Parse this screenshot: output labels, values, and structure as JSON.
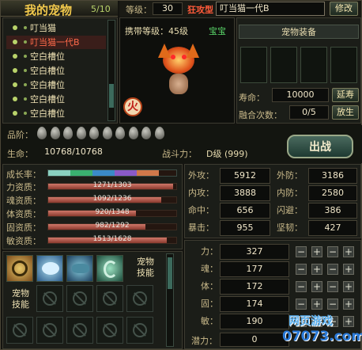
{
  "title": "我的宠物",
  "count": "5/10",
  "level_label": "等级：",
  "level": "30",
  "type": "狂攻型",
  "pet_name": "叮当猫一代B",
  "rename": "修改",
  "pets": [
    "叮当猫",
    "叮当猫一代B",
    "空白槽位",
    "空白槽位",
    "空白槽位",
    "空白槽位",
    "空白槽位"
  ],
  "carry_label": "携带等级：45级",
  "baby": "宝宝",
  "equip_title": "宠物装备",
  "life_label": "寿命：",
  "life": "10000",
  "extend": "延寿",
  "fuse_label": "融合次数：",
  "fuse": "0/5",
  "release": "放生",
  "grade_label": "品阶：",
  "hp_label": "生命：",
  "hp": "10768/10768",
  "power_label": "战斗力：",
  "power": "D级 (999)",
  "battle": "出战",
  "growth_label": "成长率：",
  "aptitudes": [
    {
      "label": "力资质：",
      "text": "1271/1303",
      "pct": 0.975
    },
    {
      "label": "魂资质：",
      "text": "1092/1236",
      "pct": 0.883
    },
    {
      "label": "体资质：",
      "text": "920/1348",
      "pct": 0.683
    },
    {
      "label": "固资质：",
      "text": "982/1292",
      "pct": 0.76
    },
    {
      "label": "敏资质：",
      "text": "1513/1628",
      "pct": 0.929
    }
  ],
  "stats": [
    {
      "l1": "外攻：",
      "v1": "5912",
      "l2": "外防：",
      "v2": "3186"
    },
    {
      "l1": "内攻：",
      "v1": "3888",
      "l2": "内防：",
      "v2": "2580"
    },
    {
      "l1": "命中：",
      "v1": "656",
      "l2": "闪避：",
      "v2": "386"
    },
    {
      "l1": "暴击：",
      "v1": "955",
      "l2": "坚韧：",
      "v2": "427"
    }
  ],
  "attrs": [
    {
      "label": "力：",
      "value": "327"
    },
    {
      "label": "魂：",
      "value": "177"
    },
    {
      "label": "体：",
      "value": "172"
    },
    {
      "label": "固：",
      "value": "174"
    },
    {
      "label": "敏：",
      "value": "190"
    }
  ],
  "potential_label": "潜力：",
  "potential": "0",
  "skill_label": "宠物技能",
  "skill_label2": "宠物技能",
  "watermark": "网页游戏",
  "watermark_url": "07073.com"
}
